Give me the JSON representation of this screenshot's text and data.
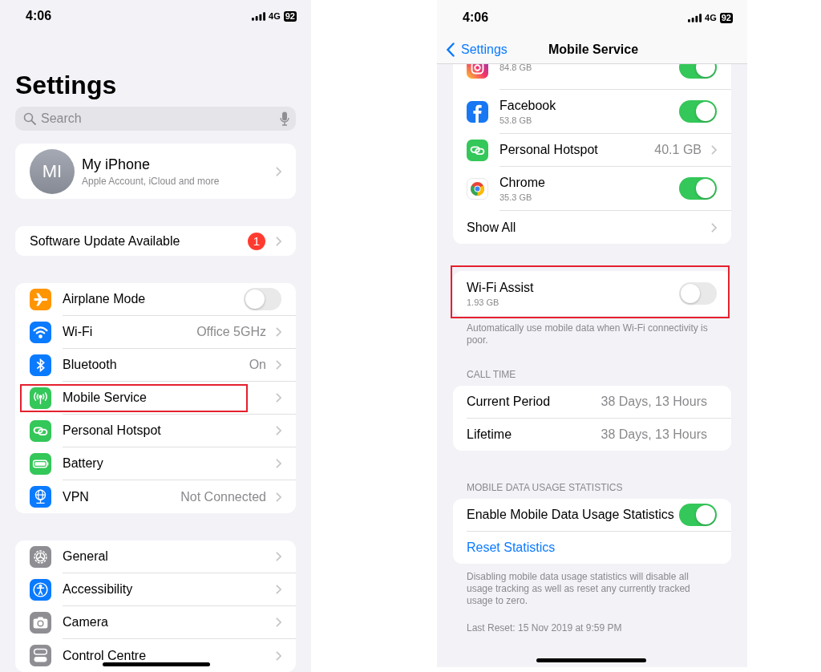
{
  "left": {
    "status": {
      "time": "4:06",
      "network": "4G",
      "battery": "92"
    },
    "title": "Settings",
    "search": {
      "placeholder": "Search"
    },
    "account": {
      "initials": "MI",
      "name": "My iPhone",
      "subtitle": "Apple Account, iCloud and more"
    },
    "update": {
      "label": "Software Update Available",
      "badge": "1"
    },
    "groups": [
      [
        {
          "kind": "toggle",
          "label": "Airplane Mode",
          "on": false,
          "color": "#ff9500",
          "highlighted": false
        },
        {
          "kind": "link",
          "label": "Wi-Fi",
          "value": "Office 5GHz",
          "color": "#0a7aff",
          "highlighted": false
        },
        {
          "kind": "link",
          "label": "Bluetooth",
          "value": "On",
          "color": "#0a7aff",
          "highlighted": false
        },
        {
          "kind": "link",
          "label": "Mobile Service",
          "color": "#34c759",
          "highlighted": true
        },
        {
          "kind": "link",
          "label": "Personal Hotspot",
          "color": "#34c759",
          "highlighted": false
        },
        {
          "kind": "link",
          "label": "Battery",
          "color": "#34c759",
          "highlighted": false
        },
        {
          "kind": "link",
          "label": "VPN",
          "value": "Not Connected",
          "color": "#0a7aff",
          "highlighted": false
        }
      ],
      [
        {
          "kind": "link",
          "label": "General",
          "color": "#8e8e93",
          "highlighted": false
        },
        {
          "kind": "link",
          "label": "Accessibility",
          "color": "#0a7aff",
          "highlighted": false
        },
        {
          "kind": "link",
          "label": "Camera",
          "color": "#8e8e93",
          "highlighted": false
        },
        {
          "kind": "link",
          "label": "Control Centre",
          "color": "#8e8e93",
          "highlighted": false
        }
      ]
    ]
  },
  "right": {
    "status": {
      "time": "4:06",
      "network": "4G",
      "battery": "92"
    },
    "nav": {
      "back": "Settings",
      "title": "Mobile Service"
    },
    "apps": [
      {
        "kind": "toggle",
        "usage": "84.8 GB",
        "on": true
      },
      {
        "kind": "toggle",
        "name": "Facebook",
        "usage": "53.8 GB",
        "on": true
      },
      {
        "kind": "link",
        "name": "Personal Hotspot",
        "value": "40.1 GB"
      },
      {
        "kind": "toggle",
        "name": "Chrome",
        "usage": "35.3 GB",
        "on": true
      },
      {
        "kind": "more",
        "name": "Show All"
      }
    ],
    "wifi_assist": {
      "label": "Wi-Fi Assist",
      "usage": "1.93 GB",
      "on": false,
      "highlighted": true,
      "footer": "Automatically use mobile data when Wi-Fi connectivity is poor."
    },
    "call_time": {
      "header": "CALL TIME",
      "rows": [
        {
          "label": "Current Period",
          "value": "38 Days, 13 Hours"
        },
        {
          "label": "Lifetime",
          "value": "38 Days, 13 Hours"
        }
      ]
    },
    "stats": {
      "header": "MOBILE DATA USAGE STATISTICS",
      "toggle": {
        "label": "Enable Mobile Data Usage Statistics",
        "on": true
      },
      "reset": "Reset Statistics",
      "footer": "Disabling mobile data usage statistics will disable all usage tracking as well as reset any currently tracked usage to zero.",
      "last_reset": "Last Reset: 15 Nov 2019 at 9:59 PM"
    }
  }
}
